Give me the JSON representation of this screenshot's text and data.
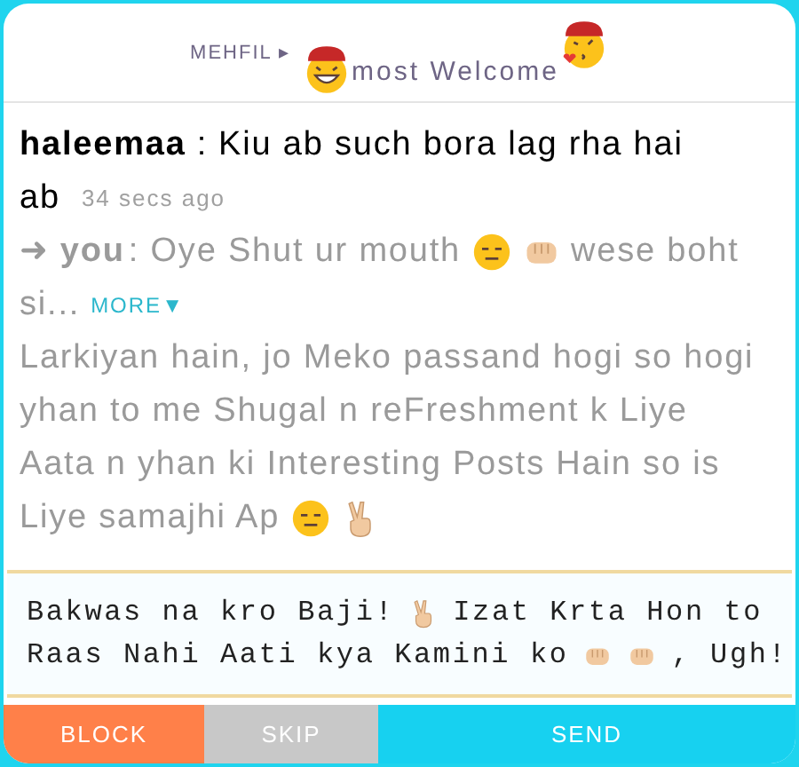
{
  "header": {
    "section": "MEHFIL ▸",
    "title": [
      {
        "kind": "grin-face-hat"
      },
      {
        "kind": "text",
        "text": "most Welcome"
      },
      {
        "kind": "kiss-face-hat"
      }
    ]
  },
  "message": [
    [
      {
        "kind": "user",
        "text": "haleemaa"
      },
      {
        "kind": "separator",
        "text": ":"
      },
      {
        "kind": "text",
        "text": "Kiu ab such bora lag rha hai"
      }
    ],
    [
      {
        "kind": "text",
        "text": "ab"
      },
      {
        "kind": "time",
        "text": "34 secs ago"
      }
    ]
  ],
  "reply": [
    [
      {
        "kind": "arrow",
        "text": "➜"
      },
      {
        "kind": "you",
        "text": "you"
      },
      {
        "kind": "text",
        "text": ": Oye Shut ur mouth"
      },
      {
        "kind": "flat-face"
      },
      {
        "kind": "fist"
      },
      {
        "kind": "text",
        "text": "wese boht"
      }
    ],
    [
      {
        "kind": "text",
        "text": "si..."
      },
      {
        "kind": "more",
        "text": "MORE▼"
      }
    ]
  ],
  "about": [
    [
      {
        "kind": "text",
        "text": "Larkiyan hain, jo Meko passand hogi so hogi"
      }
    ],
    [
      {
        "kind": "text",
        "text": "yhan to me Shugal n reFreshment k Liye"
      }
    ],
    [
      {
        "kind": "text",
        "text": "Aata n yhan ki Interesting Posts Hain so is"
      }
    ],
    [
      {
        "kind": "text",
        "text": "Liye samajhi Ap"
      },
      {
        "kind": "flat-face"
      },
      {
        "kind": "peace-hand"
      }
    ]
  ],
  "input": [
    [
      {
        "kind": "text",
        "text": "Bakwas na kro Baji!"
      },
      {
        "kind": "peace-hand"
      },
      {
        "kind": "text",
        "text": "Izat Krta Hon to"
      }
    ],
    [
      {
        "kind": "text",
        "text": "Raas Nahi Aati kya Kamini ko"
      },
      {
        "kind": "fist"
      },
      {
        "kind": "fist"
      },
      {
        "kind": "text",
        "text": ", Ugh!"
      }
    ]
  ],
  "buttons": [
    {
      "kind": "block",
      "label": "BLOCK"
    },
    {
      "kind": "skip",
      "label": "SKIP"
    },
    {
      "kind": "send",
      "label": "SEND"
    }
  ]
}
